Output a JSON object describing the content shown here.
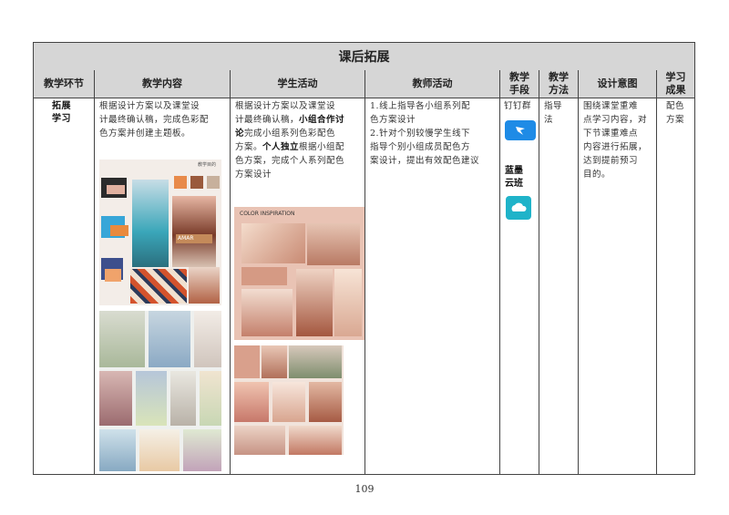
{
  "table": {
    "title": "课后拓展",
    "headers": {
      "stage": "教学环节",
      "content": "教学内容",
      "student": "学生活动",
      "teacher": "教师活动",
      "means_1": "教学",
      "means_2": "手段",
      "method_1": "教学",
      "method_2": "方法",
      "intent": "设计意图",
      "result_1": "学习",
      "result_2": "成果"
    },
    "row": {
      "stage_1": "拓展",
      "stage_2": "学习",
      "content_lines": [
        "根据设计方案以及课堂设",
        "计最终确认稿，完成色彩配",
        "色方案并创建主题板。"
      ],
      "student_line1": "根据设计方案以及课堂设",
      "student_line2_a": "计最终确认稿，",
      "student_line2_b": "小组合作讨",
      "student_line3_a": "论",
      "student_line3_b": "完成小组系列色彩配色",
      "student_line4_a": "方案。",
      "student_line4_b": "个人独立",
      "student_line4_c": "根据小组配",
      "student_line5": "色方案，完成个人系列配色",
      "student_line6": "方案设计",
      "teacher_lines": [
        "1.线上指导各小组系列配",
        "色方案设计",
        "2.针对个别较慢学生线下",
        "指导个别小组成员配色方",
        "案设计，提出有效配色建议"
      ],
      "tool_1": "钉钉群",
      "tool_2a": "蓝墨",
      "tool_2b": "云班",
      "method_lines": [
        "指导",
        "法"
      ],
      "intent_lines": [
        "围绕课堂重难",
        "点学习内容，对",
        "下节课重难点",
        "内容进行拓展，",
        "达到提前预习",
        "目的。"
      ],
      "result_lines": [
        "配色",
        "方案"
      ]
    },
    "moodboard_1": {
      "label": "教学目的",
      "brand": "AMAR"
    },
    "moodboard_2": {
      "label": "COLOR INSPIRATION"
    }
  },
  "page_number": "109",
  "colors": {
    "header_bg": "#d6d6d6",
    "dingtalk": "#1e8be6",
    "lanmo": "#1fb3c9",
    "blush": "#d9a08c"
  },
  "icons": [
    "dingtalk-icon",
    "lanmo-cloud-icon"
  ]
}
